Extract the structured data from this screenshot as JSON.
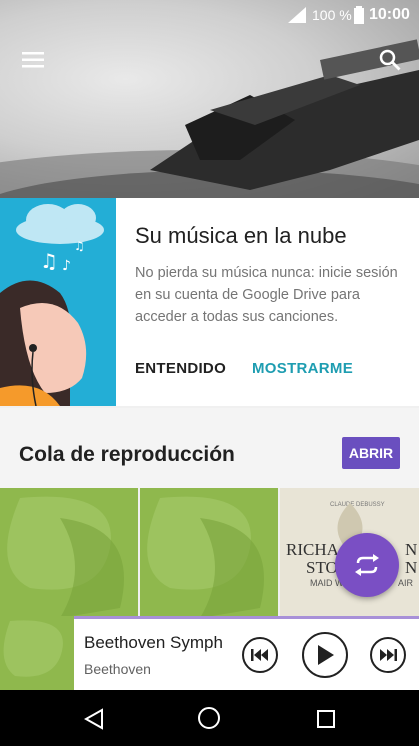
{
  "status": {
    "battery_text": "100 %",
    "time": "10:00"
  },
  "header": {
    "menu_icon": "menu-icon",
    "search_icon": "search-icon"
  },
  "cloud_card": {
    "title": "Su música en la nube",
    "body": "No pierda su música nunca: inicie sesión en su cuenta de Google Drive para acceder a todas sus canciones.",
    "dismiss_label": "ENTENDIDO",
    "show_label": "MOSTRARME"
  },
  "queue": {
    "title": "Cola de reproducción",
    "open_label": "ABRIR",
    "album_text": {
      "composer": "CLAUDE DEBUSSY",
      "line1": "RICHA",
      "line1b": "N",
      "line2": "STO",
      "line2b": "N",
      "line3": "MAID W",
      "line3b": "AIR"
    }
  },
  "player": {
    "track": "Beethoven Symph",
    "artist": "Beethoven"
  },
  "colors": {
    "accent": "#6a4fbf",
    "teal": "#1e9db1",
    "green": "#8fb84d",
    "sky": "#23aed6"
  }
}
